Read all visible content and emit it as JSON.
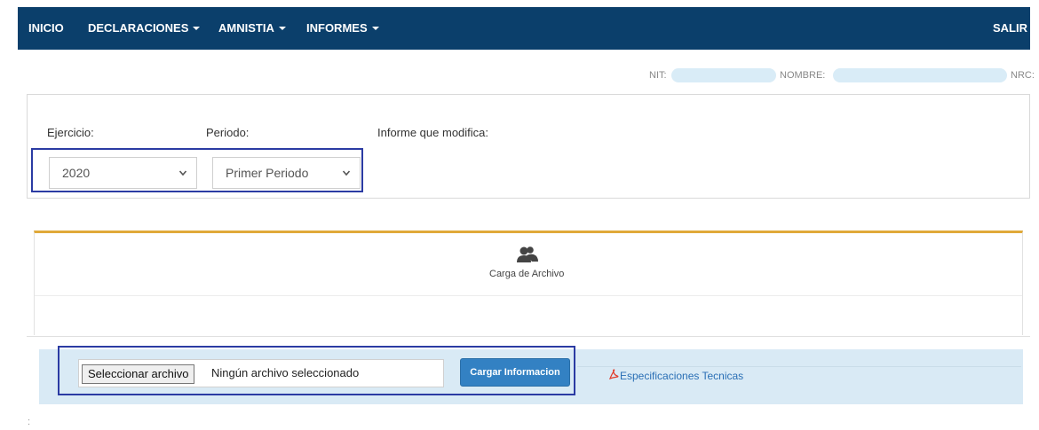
{
  "nav": {
    "items": [
      {
        "label": "INICIO",
        "dropdown": false
      },
      {
        "label": "DECLARACIONES",
        "dropdown": true
      },
      {
        "label": "AMNISTIA",
        "dropdown": true
      },
      {
        "label": "INFORMES",
        "dropdown": true
      }
    ],
    "logout": "SALIR",
    "color": "#0b3f6b"
  },
  "header": {
    "nit_label": "NIT:",
    "nombre_label": "NOMBRE:",
    "nrc_label": "NRC:"
  },
  "form": {
    "ejercicio_label": "Ejercicio:",
    "periodo_label": "Periodo:",
    "informe_label": "Informe que modifica:",
    "ejercicio_value": "2020",
    "periodo_value": "Primer Periodo"
  },
  "tab": {
    "icon": "users-icon",
    "label": "Carga de Archivo",
    "accent": "#e0a939"
  },
  "upload": {
    "file_button": "Seleccionar archivo",
    "file_status": "Ningún archivo seleccionado",
    "submit_button": "Cargar Informacion",
    "spec_link": "Especificaciones Tecnicas",
    "spec_icon": "pdf-icon"
  },
  "highlight_color": "#2b3ba3"
}
